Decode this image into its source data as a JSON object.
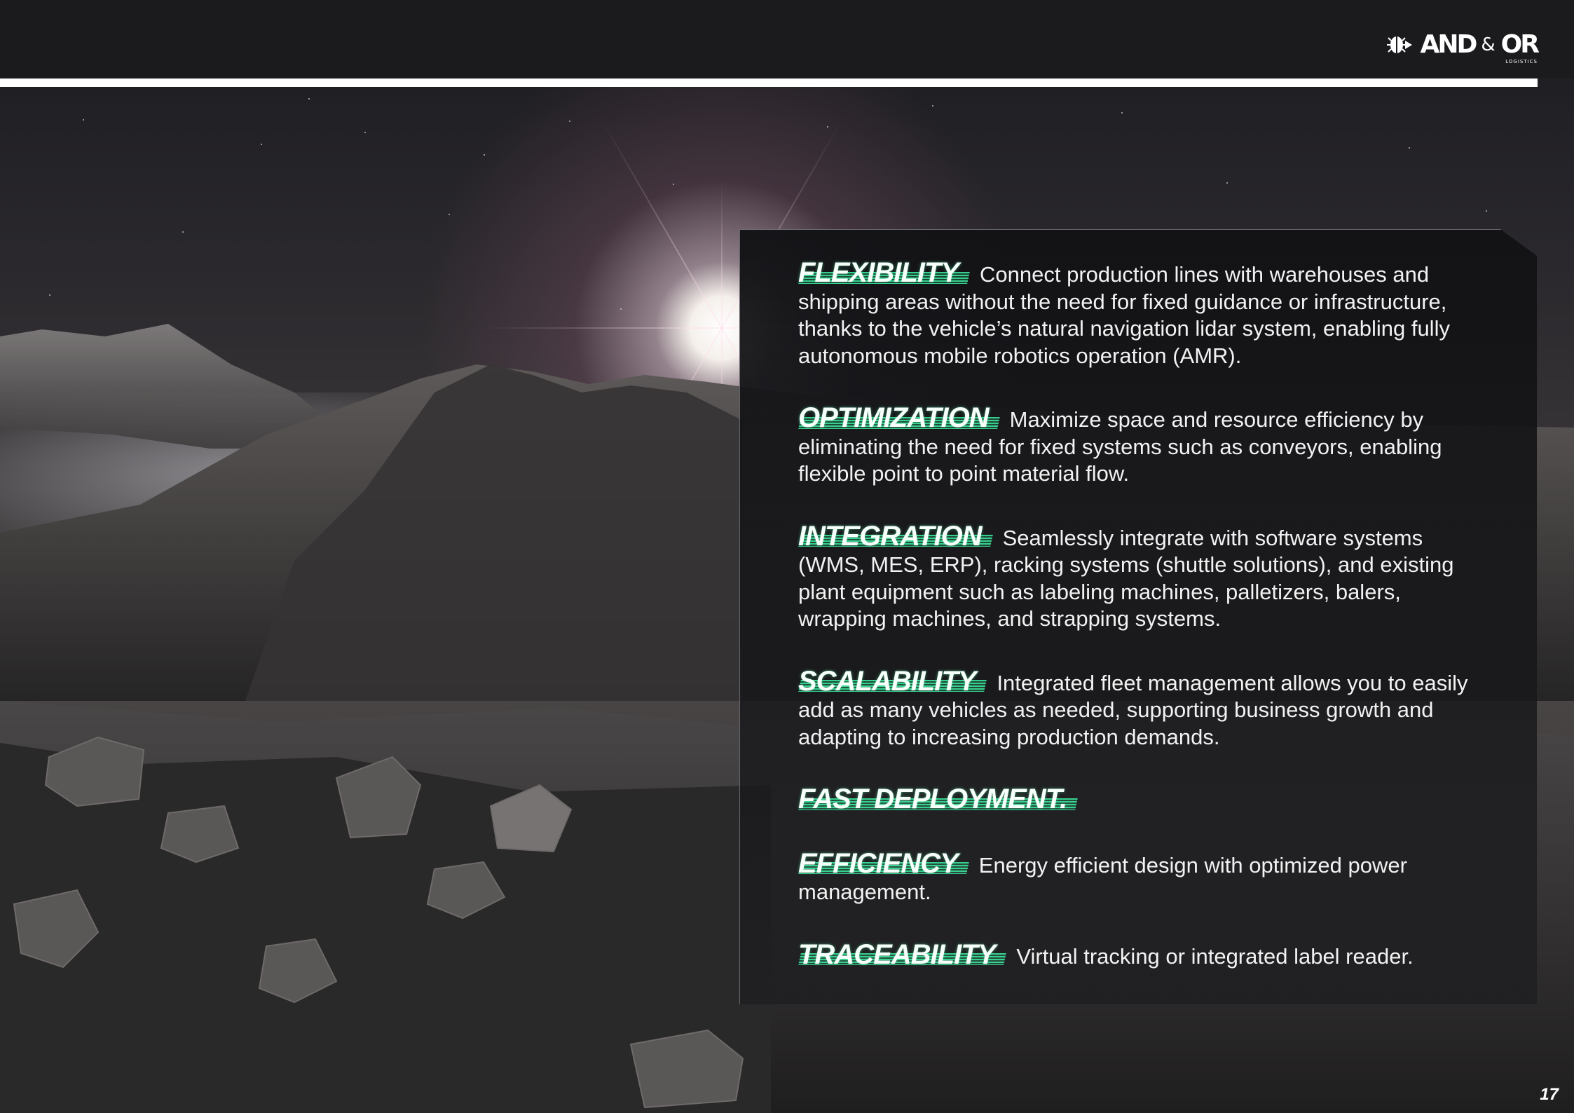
{
  "brand": {
    "name_left": "AND",
    "amp": "&",
    "name_right": "OR",
    "tagline": "LOGISTICS",
    "logo_icon": "and-or-bug-icon"
  },
  "features": [
    {
      "title": "FLEXIBILITY",
      "text": "Connect production lines with warehouses and shipping areas without the need for fixed guidance or infrastructure, thanks to the vehicle’s natural navigation lidar system, enabling fully autonomous mobile robotics operation (AMR)."
    },
    {
      "title": "OPTIMIZATION",
      "text": "Maximize space and resource efficiency by eliminating the need for fixed systems such as conveyors, enabling flexible point to point material flow."
    },
    {
      "title": "INTEGRATION",
      "text": "Seamlessly integrate with software systems (WMS, MES, ERP), racking systems (shuttle solutions), and existing plant equipment such as labeling machines, palletizers, balers, wrapping machines, and strapping systems."
    },
    {
      "title": "SCALABILITY",
      "text": "Integrated fleet management allows you to easily add as many vehicles as needed, supporting business growth and adapting to increasing production demands."
    },
    {
      "title": "FAST DEPLOYMENT.",
      "text": ""
    },
    {
      "title": "EFFICIENCY",
      "text": "Energy efficient design with optimized power management."
    },
    {
      "title": "TRACEABILITY",
      "text": "Virtual tracking or integrated label reader."
    }
  ],
  "page_number": "17",
  "colors": {
    "accent": "#3bf0a2",
    "header_bar": "#1b1b1e",
    "rule": "#ffffff",
    "panel": "#141417"
  }
}
